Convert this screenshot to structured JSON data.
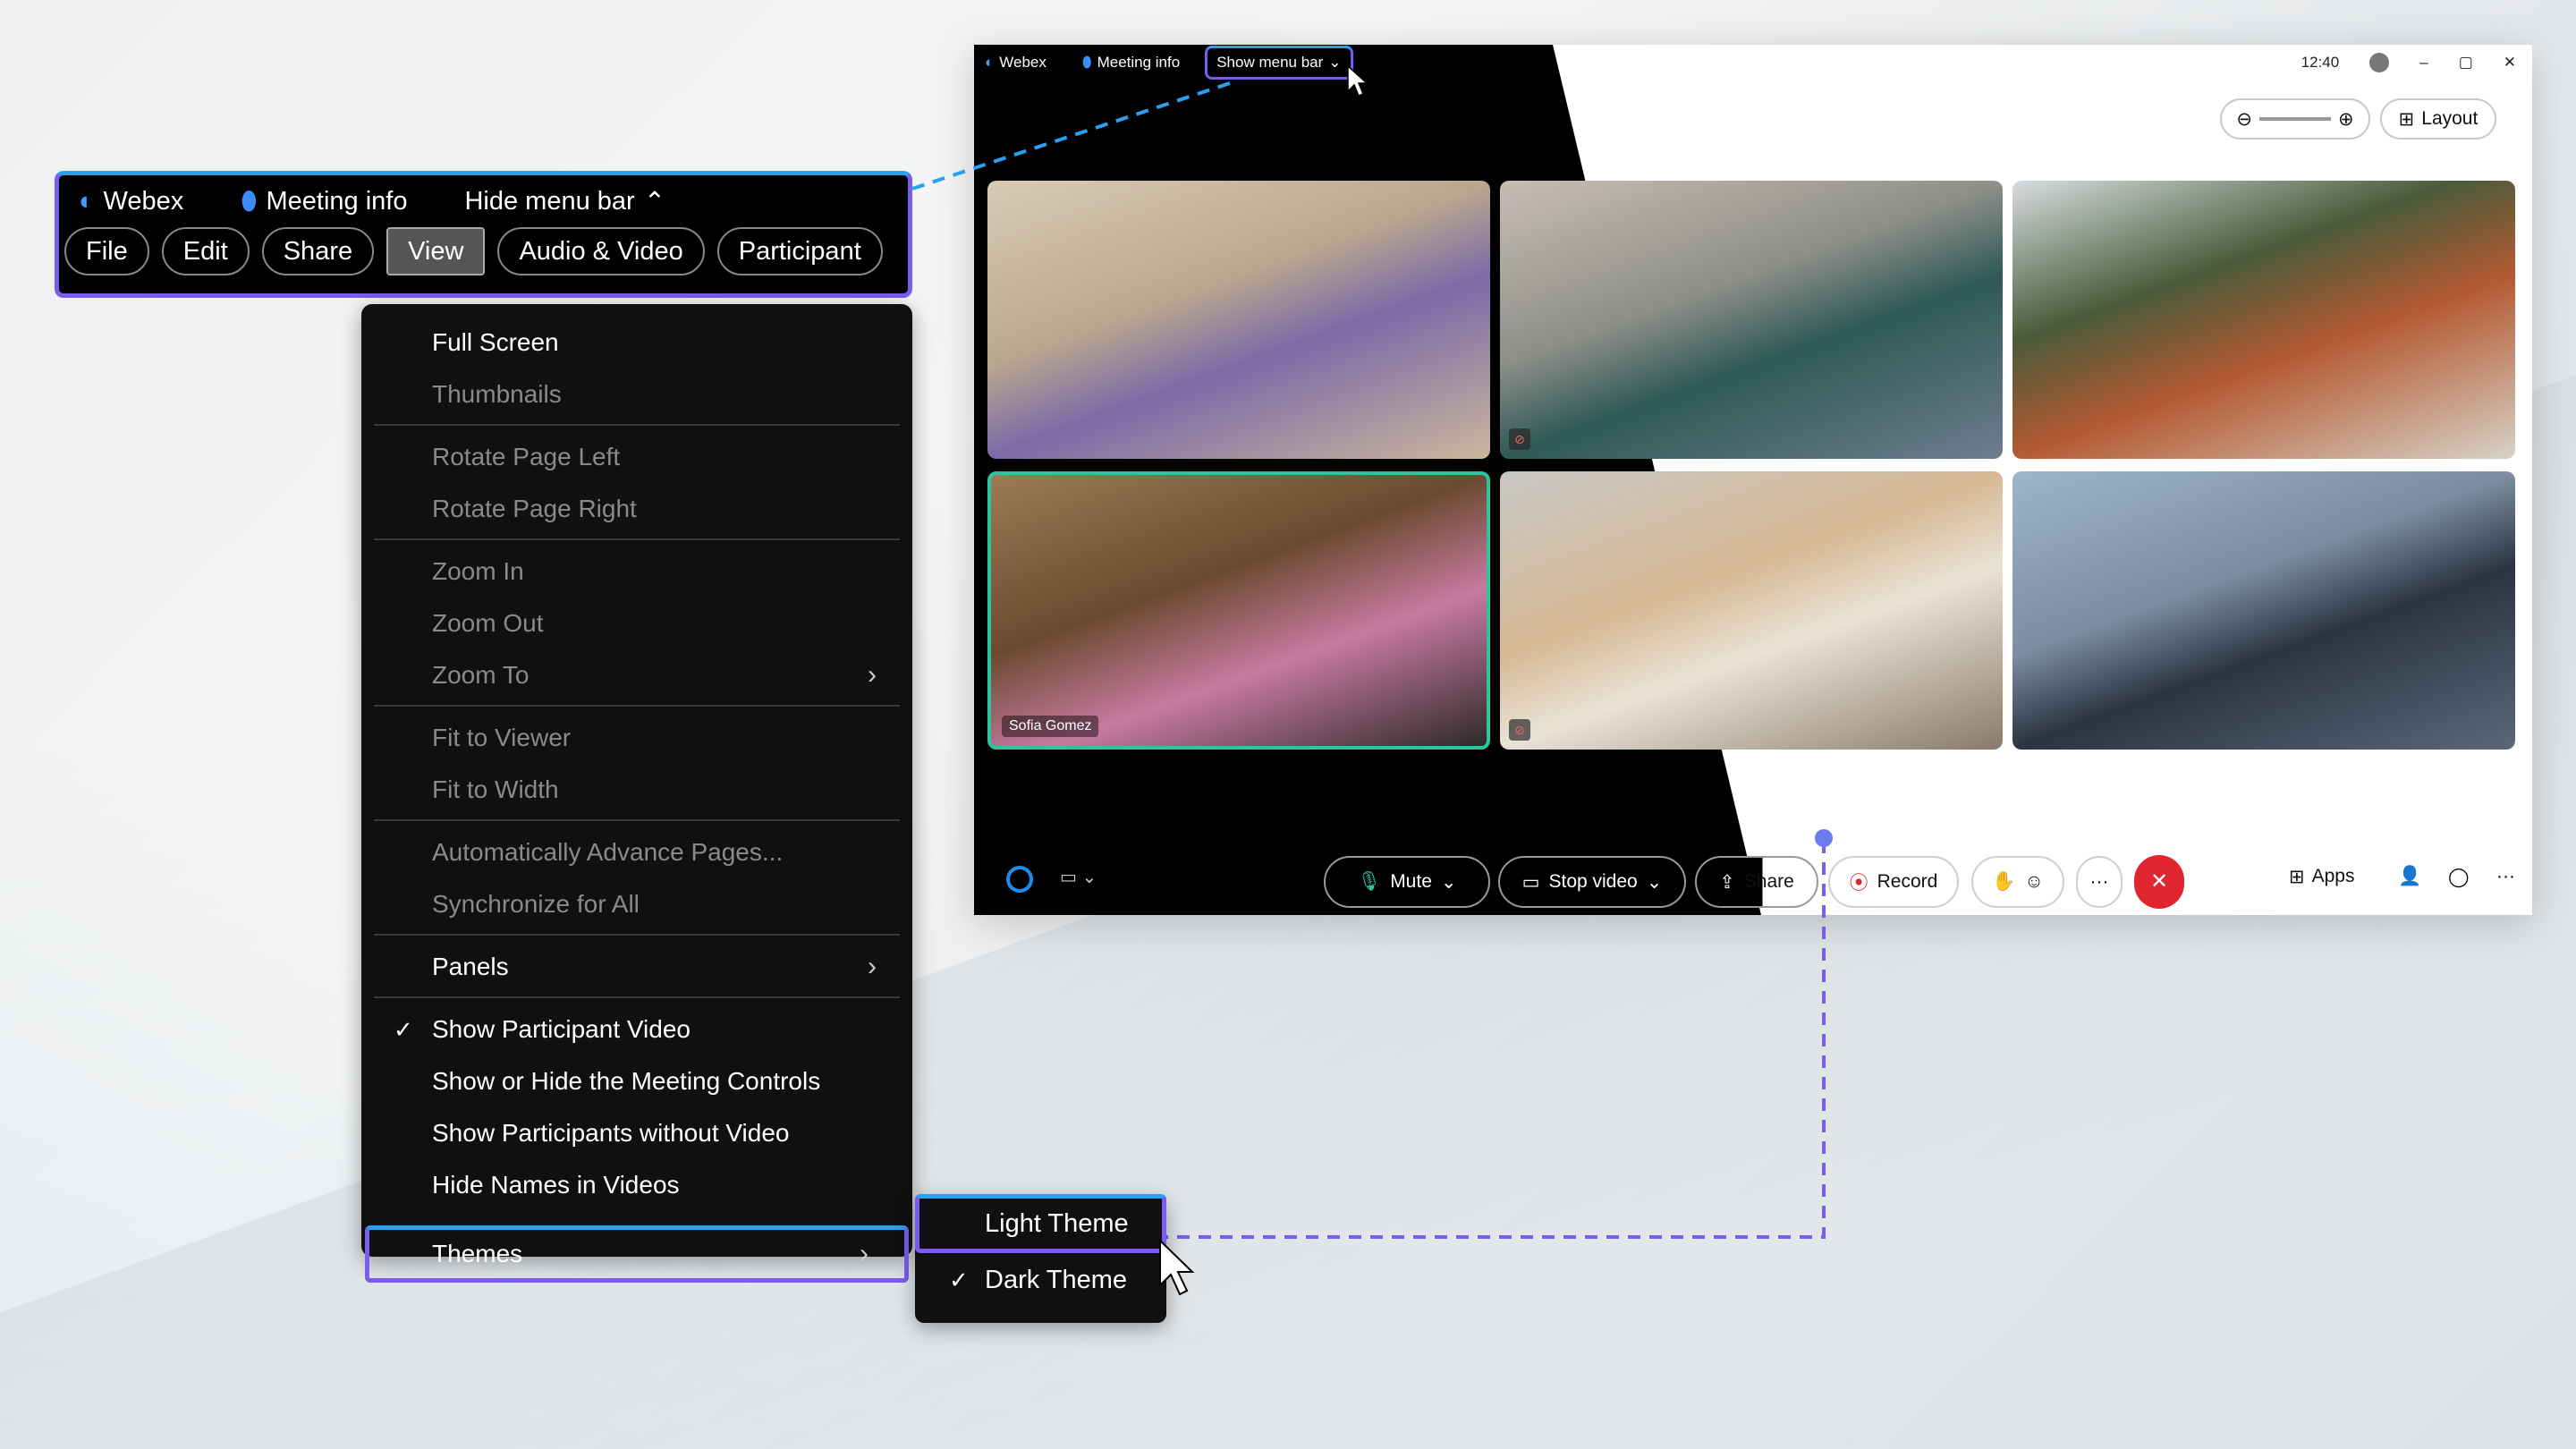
{
  "window": {
    "tabs": {
      "webex": "Webex",
      "meeting_info": "Meeting info",
      "show_menu_bar": "Show menu bar"
    },
    "time": "12:40",
    "layout_label": "Layout"
  },
  "tiles": [
    {
      "name": ""
    },
    {
      "name": ""
    },
    {
      "name": ""
    },
    {
      "name": "Sofia Gomez",
      "active": true
    },
    {
      "name": ""
    },
    {
      "name": ""
    }
  ],
  "controls": {
    "mute": "Mute",
    "stop_video": "Stop video",
    "share": "Share",
    "record": "Record",
    "apps": "Apps",
    "more": "···"
  },
  "menubar": {
    "webex": "Webex",
    "meeting_info": "Meeting info",
    "hide_menu_bar": "Hide menu bar",
    "menus": [
      "File",
      "Edit",
      "Share",
      "View",
      "Audio & Video",
      "Participant"
    ],
    "selected": "View"
  },
  "view_menu": {
    "groups": [
      [
        {
          "label": "Full Screen",
          "enabled": true
        },
        {
          "label": "Thumbnails",
          "enabled": false
        }
      ],
      [
        {
          "label": "Rotate Page Left",
          "enabled": false
        },
        {
          "label": "Rotate Page Right",
          "enabled": false
        }
      ],
      [
        {
          "label": "Zoom In",
          "enabled": false
        },
        {
          "label": "Zoom Out",
          "enabled": false
        },
        {
          "label": "Zoom To",
          "enabled": false,
          "submenu": true
        }
      ],
      [
        {
          "label": "Fit to Viewer",
          "enabled": false
        },
        {
          "label": "Fit to Width",
          "enabled": false
        }
      ],
      [
        {
          "label": "Automatically Advance Pages...",
          "enabled": false
        },
        {
          "label": "Synchronize for All",
          "enabled": false
        }
      ],
      [
        {
          "label": "Panels",
          "enabled": true,
          "submenu": true
        }
      ],
      [
        {
          "label": "Show Participant Video",
          "enabled": true,
          "checked": true
        },
        {
          "label": "Show or Hide the Meeting Controls",
          "enabled": true
        },
        {
          "label": "Show Participants without Video",
          "enabled": true
        },
        {
          "label": "Hide Names in Videos",
          "enabled": true
        }
      ]
    ],
    "themes": "Themes"
  },
  "themes_menu": [
    {
      "label": "Light Theme",
      "highlighted": true
    },
    {
      "label": "Dark Theme",
      "checked": true
    }
  ],
  "colors": {
    "accent_blue": "#2aa0f0",
    "accent_purple": "#7b5cf0",
    "end_call": "#e0252f",
    "active_tile": "#2ec4a0"
  }
}
